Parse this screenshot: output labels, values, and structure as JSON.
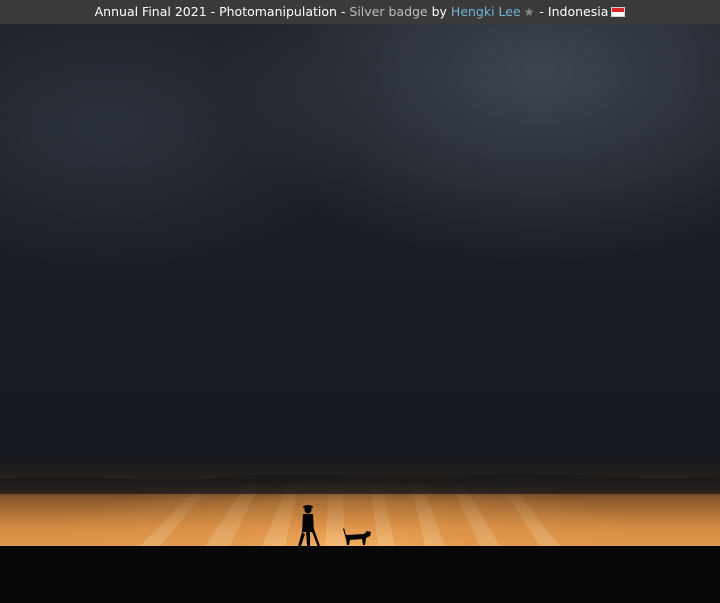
{
  "caption": {
    "title": "Annual Final 2021 - Photomanipulation - ",
    "badge": "Silver badge",
    "by": " by ",
    "author": "Hengki Lee",
    "dash": " - ",
    "country": "Indonesia",
    "star_icon": "star-icon",
    "flag_icon": "indonesia-flag-icon"
  },
  "photo": {
    "subject": "storm clouds over a glowing horizon with a person and a dog walking"
  }
}
